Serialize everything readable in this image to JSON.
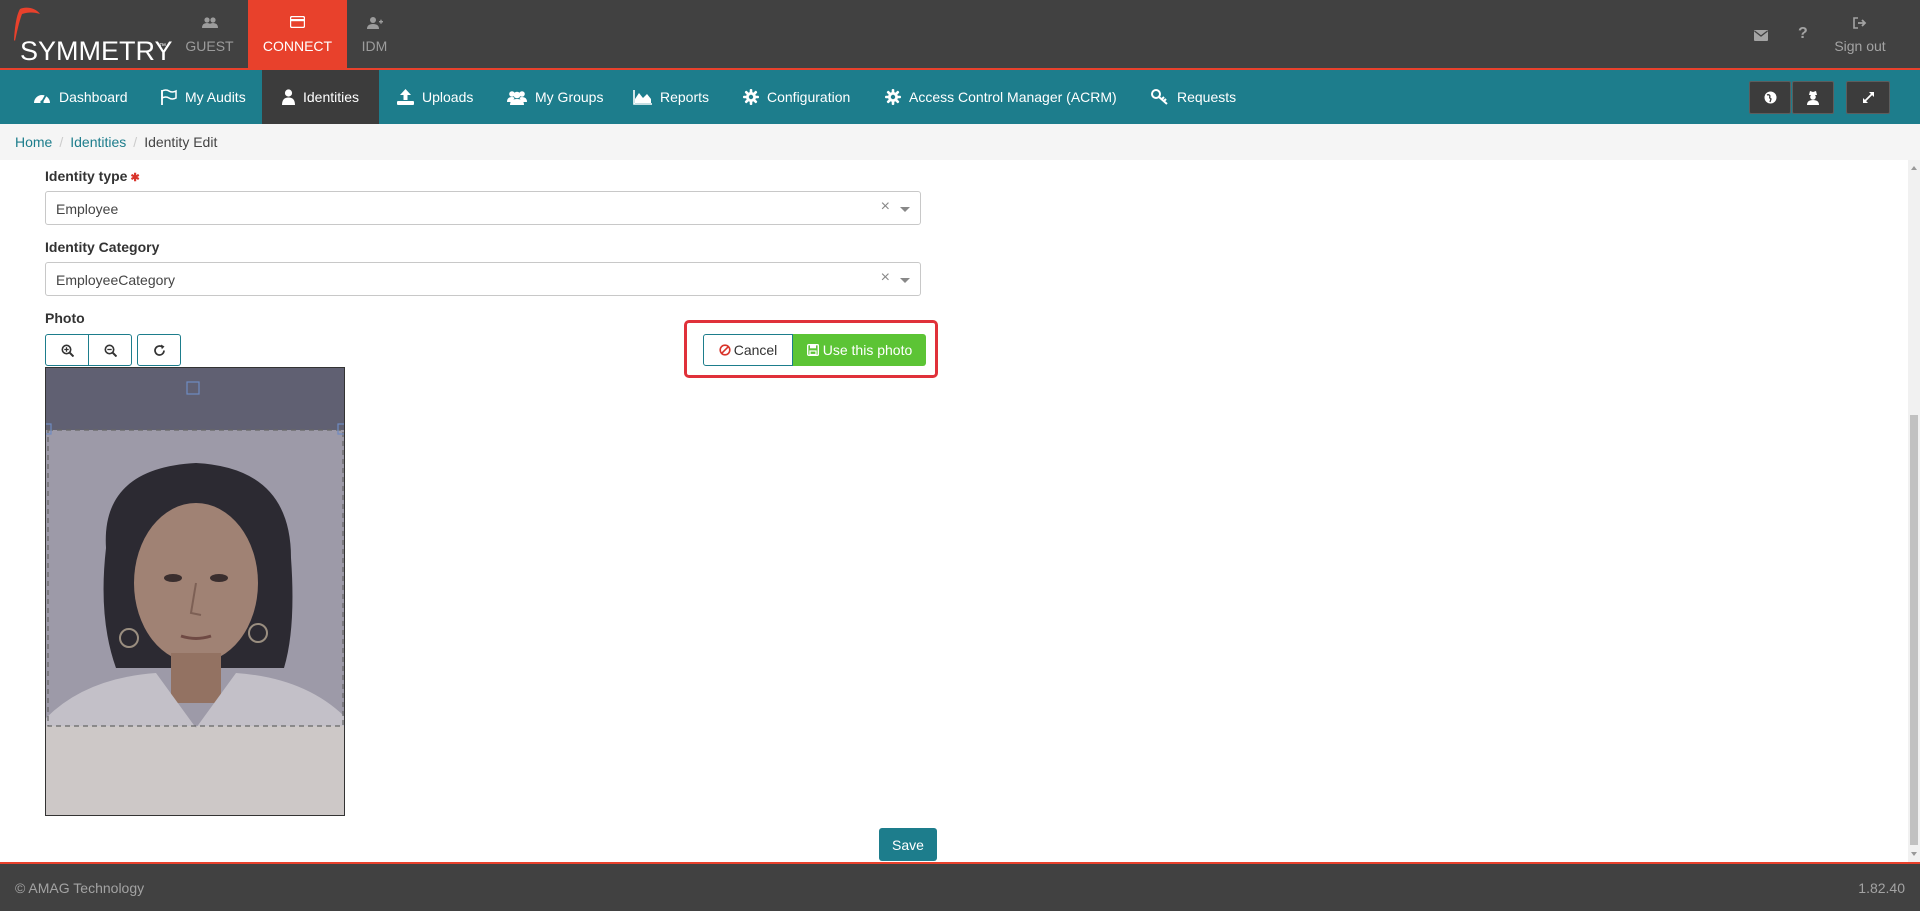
{
  "brand": {
    "name": "SYMMETRY",
    "tm": "™"
  },
  "app_tabs": [
    {
      "label": "GUEST",
      "icon": "users-icon"
    },
    {
      "label": "CONNECT",
      "icon": "card-icon",
      "active": true
    },
    {
      "label": "IDM",
      "icon": "user-plus-icon"
    }
  ],
  "top_right": {
    "mail_icon": "envelope-icon",
    "help_label": "?",
    "signout_label": "Sign out"
  },
  "nav": [
    {
      "label": "Dashboard",
      "icon": "dashboard-icon"
    },
    {
      "label": "My Audits",
      "icon": "flag-icon"
    },
    {
      "label": "Identities",
      "icon": "user-icon",
      "active": true
    },
    {
      "label": "Uploads",
      "icon": "upload-icon"
    },
    {
      "label": "My Groups",
      "icon": "users-icon"
    },
    {
      "label": "Reports",
      "icon": "area-chart-icon"
    },
    {
      "label": "Configuration",
      "icon": "gear-icon"
    },
    {
      "label": "Access Control Manager (ACRM)",
      "icon": "gear-icon"
    },
    {
      "label": "Requests",
      "icon": "key-icon"
    }
  ],
  "breadcrumb": {
    "home": "Home",
    "identities": "Identities",
    "current": "Identity Edit"
  },
  "form": {
    "identity_type": {
      "label": "Identity type",
      "required_mark": "✱",
      "value": "Employee",
      "clear": "×"
    },
    "identity_category": {
      "label": "Identity Category",
      "value": "EmployeeCategory",
      "clear": "×"
    },
    "photo": {
      "label": "Photo"
    },
    "cancel_label": "Cancel",
    "use_photo_label": "Use this photo",
    "save_label": "Save"
  },
  "footer": {
    "copyright": "© AMAG Technology",
    "version": "1.82.40"
  },
  "colors": {
    "accent": "#1d7d8c",
    "brand_red": "#e8412c",
    "success": "#5cc435",
    "dark": "#414141"
  }
}
